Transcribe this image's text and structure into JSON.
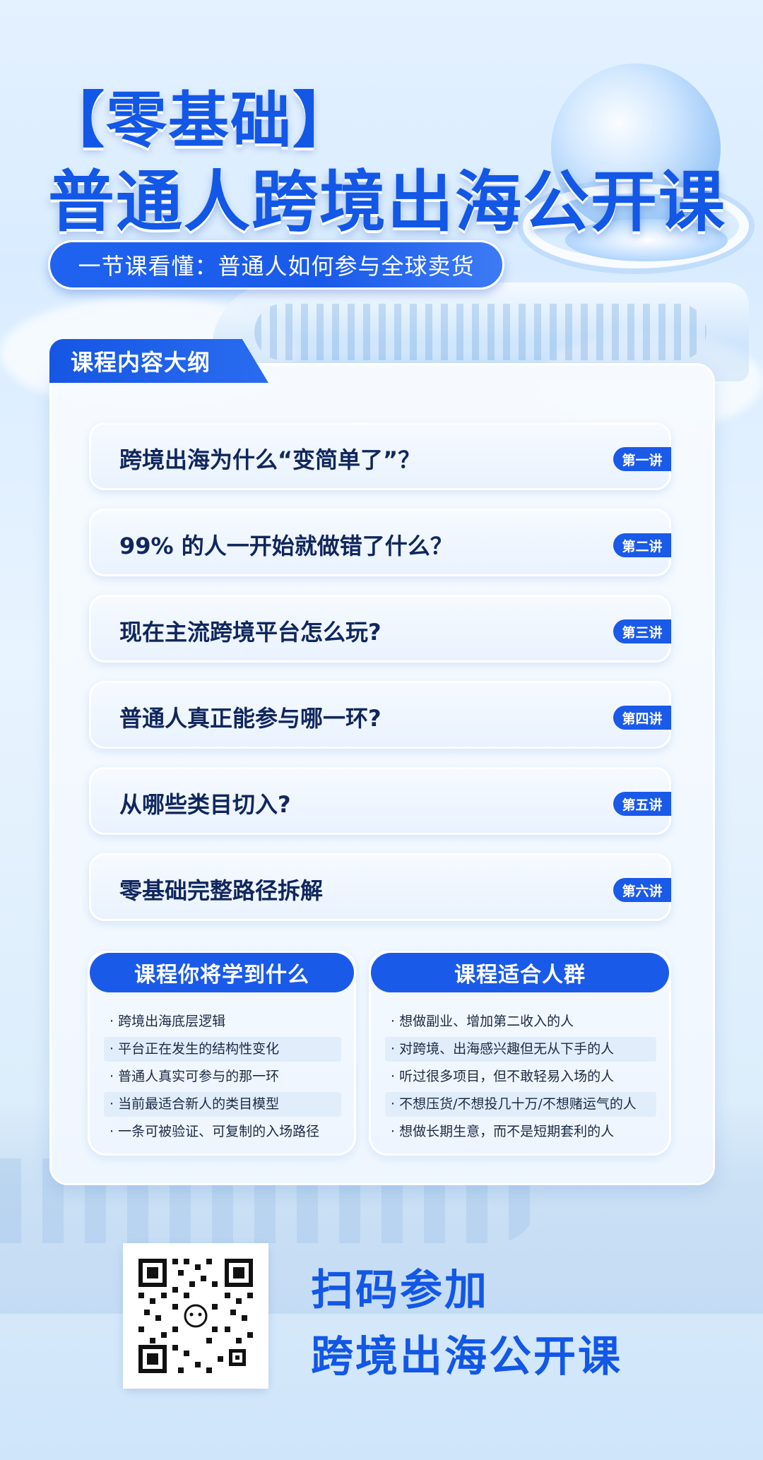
{
  "header": {
    "tag": "【零基础】",
    "title": "普通人跨境出海公开课",
    "subtitle": "一节课看懂：普通人如何参与全球卖货"
  },
  "outline": {
    "heading": "课程内容大纲",
    "lessons": [
      {
        "text": "跨境出海为什么“变简单了”？",
        "badge": "第一讲"
      },
      {
        "text": "99% 的人一开始就做错了什么？",
        "badge": "第二讲"
      },
      {
        "text": "现在主流跨境平台怎么玩?",
        "badge": "第三讲"
      },
      {
        "text": "普通人真正能参与哪一环?",
        "badge": "第四讲"
      },
      {
        "text": "从哪些类目切入?",
        "badge": "第五讲"
      },
      {
        "text": "零基础完整路径拆解",
        "badge": "第六讲"
      }
    ]
  },
  "learn": {
    "heading": "课程你将学到什么",
    "items": [
      "· 跨境出海底层逻辑",
      "· 平台正在发生的结构性变化",
      "· 普通人真实可参与的那一环",
      "· 当前最适合新人的类目模型",
      "· 一条可被验证、可复制的入场路径"
    ]
  },
  "audience": {
    "heading": "课程适合人群",
    "items": [
      "· 想做副业、增加第二收入的人",
      "· 对跨境、出海感兴趣但无从下手的人",
      "· 听过很多项目，但不敢轻易入场的人",
      "· 不想压货/不想投几十万/不想赌运气的人",
      "· 想做长期生意，而不是短期套利的人"
    ]
  },
  "cta": {
    "line1": "扫码参加",
    "line2": "跨境出海公开课"
  },
  "colors": {
    "brand_blue": "#1a5ae8",
    "title_blue": "#1257e6",
    "dark_text": "#10275e"
  }
}
